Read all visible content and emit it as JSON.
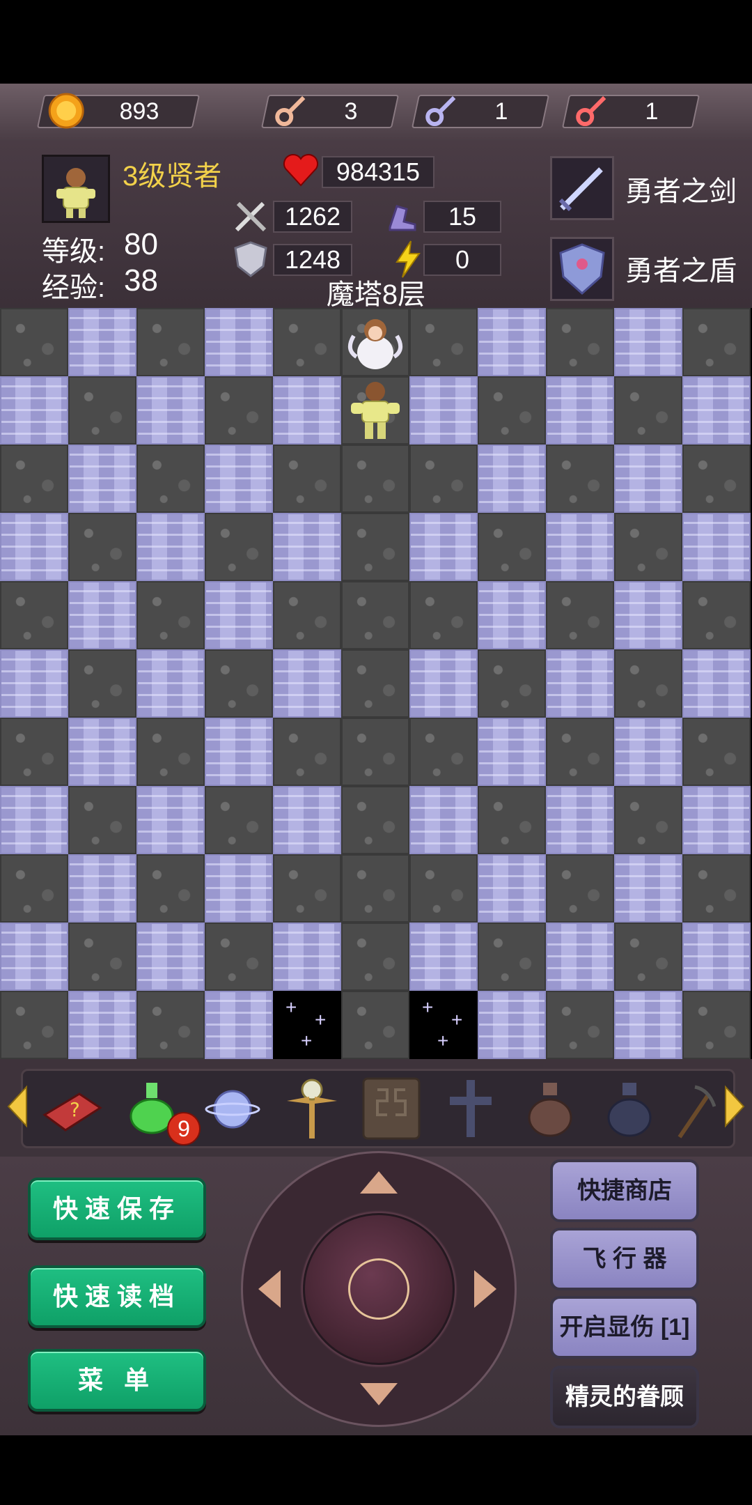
{
  "resources": {
    "gold": "893",
    "yellow_keys": "3",
    "blue_keys": "1",
    "red_keys": "1"
  },
  "hero": {
    "title": "3级贤者",
    "level_label": "等级:",
    "level": "80",
    "exp_label": "经验:",
    "exp": "38",
    "hp": "984315",
    "attack": "1262",
    "defense": "1248",
    "magic_defense": "15",
    "speed": "0"
  },
  "floor": "魔塔8层",
  "equipment": {
    "weapon": "勇者之剑",
    "armor": "勇者之盾"
  },
  "inventory": {
    "potion_count": "9"
  },
  "buttons": {
    "quick_save": "快速保存",
    "quick_load": "快速读档",
    "menu": "菜 单",
    "shop": "快捷商店",
    "fly": "飞 行 器",
    "damage": "开启显伤 [1]",
    "blessing": "精灵的眷顾"
  },
  "colors": {
    "accent_green": "#1fbf82",
    "accent_purple": "#a9a3d6",
    "rank_yellow": "#f2d14a"
  }
}
